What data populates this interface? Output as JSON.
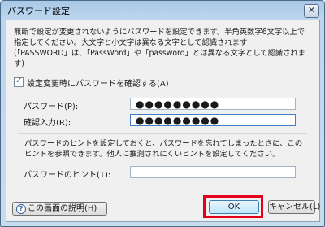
{
  "window": {
    "title": "パスワード設定",
    "close_glyph": "✕"
  },
  "description": "無断で設定が変更されないようにパスワードを設定できます。半角英数字6文字以上で\n指定してください。大文字と小文字は異なる文字として認識されます\n(「PASSWORD」は、「PassWord」や「password」とは異なる文字として認識されま\nす)",
  "confirm_checkbox": {
    "label": "設定変更時にパスワードを確認する(A)",
    "checked": true,
    "check_glyph": "✓"
  },
  "password": {
    "label": "パスワード(P):",
    "value": "●●●●●●●●●"
  },
  "confirm": {
    "label": "確認入力(R):",
    "value": "●●●●●●●●●"
  },
  "hint_description": "パスワードのヒントを設定しておくと、パスワードを忘れてしまったときに、この\nヒントを参照できます。他人に推測されにくいヒントを設定してください。",
  "hint": {
    "label": "パスワードのヒント(T):",
    "value": ""
  },
  "buttons": {
    "help": "この画面の説明(H)",
    "help_icon": "?",
    "ok": "OK",
    "cancel": "キャンセル(L)"
  },
  "colors": {
    "highlight_outline": "#e3001b"
  }
}
